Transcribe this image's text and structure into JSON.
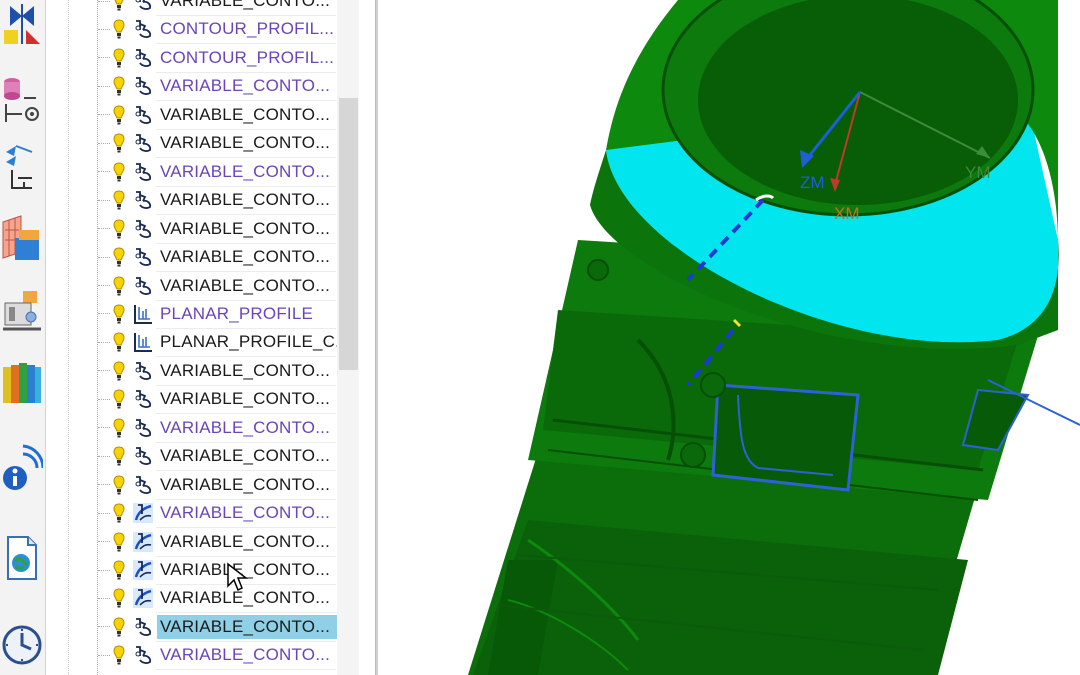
{
  "navigator": {
    "operations": [
      {
        "label": "VARIABLE_CONTO...",
        "color": "black",
        "type": "contour-icon",
        "selected": false
      },
      {
        "label": "CONTOUR_PROFIL...",
        "color": "purple",
        "type": "contour-icon",
        "selected": false
      },
      {
        "label": "CONTOUR_PROFIL...",
        "color": "purple",
        "type": "contour-icon",
        "selected": false
      },
      {
        "label": "VARIABLE_CONTO...",
        "color": "purple",
        "type": "contour-icon",
        "selected": false
      },
      {
        "label": "VARIABLE_CONTO...",
        "color": "black",
        "type": "contour-icon",
        "selected": false
      },
      {
        "label": "VARIABLE_CONTO...",
        "color": "black",
        "type": "contour-icon",
        "selected": false
      },
      {
        "label": "VARIABLE_CONTO...",
        "color": "purple",
        "type": "contour-icon",
        "selected": false
      },
      {
        "label": "VARIABLE_CONTO...",
        "color": "black",
        "type": "contour-icon",
        "selected": false
      },
      {
        "label": "VARIABLE_CONTO...",
        "color": "black",
        "type": "contour-icon",
        "selected": false
      },
      {
        "label": "VARIABLE_CONTO...",
        "color": "black",
        "type": "contour-icon",
        "selected": false
      },
      {
        "label": "VARIABLE_CONTO...",
        "color": "black",
        "type": "contour-icon",
        "selected": false
      },
      {
        "label": "PLANAR_PROFILE",
        "color": "purple",
        "type": "planar-profile-icon",
        "selected": false
      },
      {
        "label": "PLANAR_PROFILE_C...",
        "color": "black",
        "type": "planar-profile-icon",
        "selected": false
      },
      {
        "label": "VARIABLE_CONTO...",
        "color": "black",
        "type": "contour-icon",
        "selected": false
      },
      {
        "label": "VARIABLE_CONTO...",
        "color": "black",
        "type": "contour-icon",
        "selected": false
      },
      {
        "label": "VARIABLE_CONTO...",
        "color": "purple",
        "type": "contour-icon",
        "selected": false
      },
      {
        "label": "VARIABLE_CONTO...",
        "color": "black",
        "type": "contour-icon",
        "selected": false
      },
      {
        "label": "VARIABLE_CONTO...",
        "color": "black",
        "type": "contour-icon",
        "selected": false
      },
      {
        "label": "VARIABLE_CONTO...",
        "color": "purple",
        "type": "variable-contour-blue-icon",
        "selected": false
      },
      {
        "label": "VARIABLE_CONTO...",
        "color": "black",
        "type": "variable-contour-blue-icon",
        "selected": false
      },
      {
        "label": "VARIABLE_CONTO...",
        "color": "black",
        "type": "variable-contour-blue-icon",
        "selected": false
      },
      {
        "label": "VARIABLE_CONTO...",
        "color": "black",
        "type": "variable-contour-blue-icon",
        "selected": false
      },
      {
        "label": "VARIABLE_CONTO...",
        "color": "black",
        "type": "contour-icon",
        "selected": true
      },
      {
        "label": "VARIABLE_CONTO...",
        "color": "purple",
        "type": "contour-icon",
        "selected": false
      }
    ]
  },
  "resource_bar": {
    "icons": [
      "assembly-constraint-icon",
      "part-navigator-icon",
      "operation-navigator-icon",
      "machine-tool-icon",
      "process-icon",
      "library-icon",
      "information-icon",
      "web-browser-icon",
      "history-icon"
    ]
  },
  "viewport": {
    "axis_labels": {
      "ym": "YM",
      "zm": "ZM",
      "xm": "XM"
    },
    "colors": {
      "part_green": "#0a7a0a",
      "dark_green": "#064f06",
      "highlight_cyan": "#00e5ee",
      "axis_blue": "#1e5fd8",
      "axis_red": "#c0392b",
      "axis_green": "#3b8c3b"
    }
  }
}
